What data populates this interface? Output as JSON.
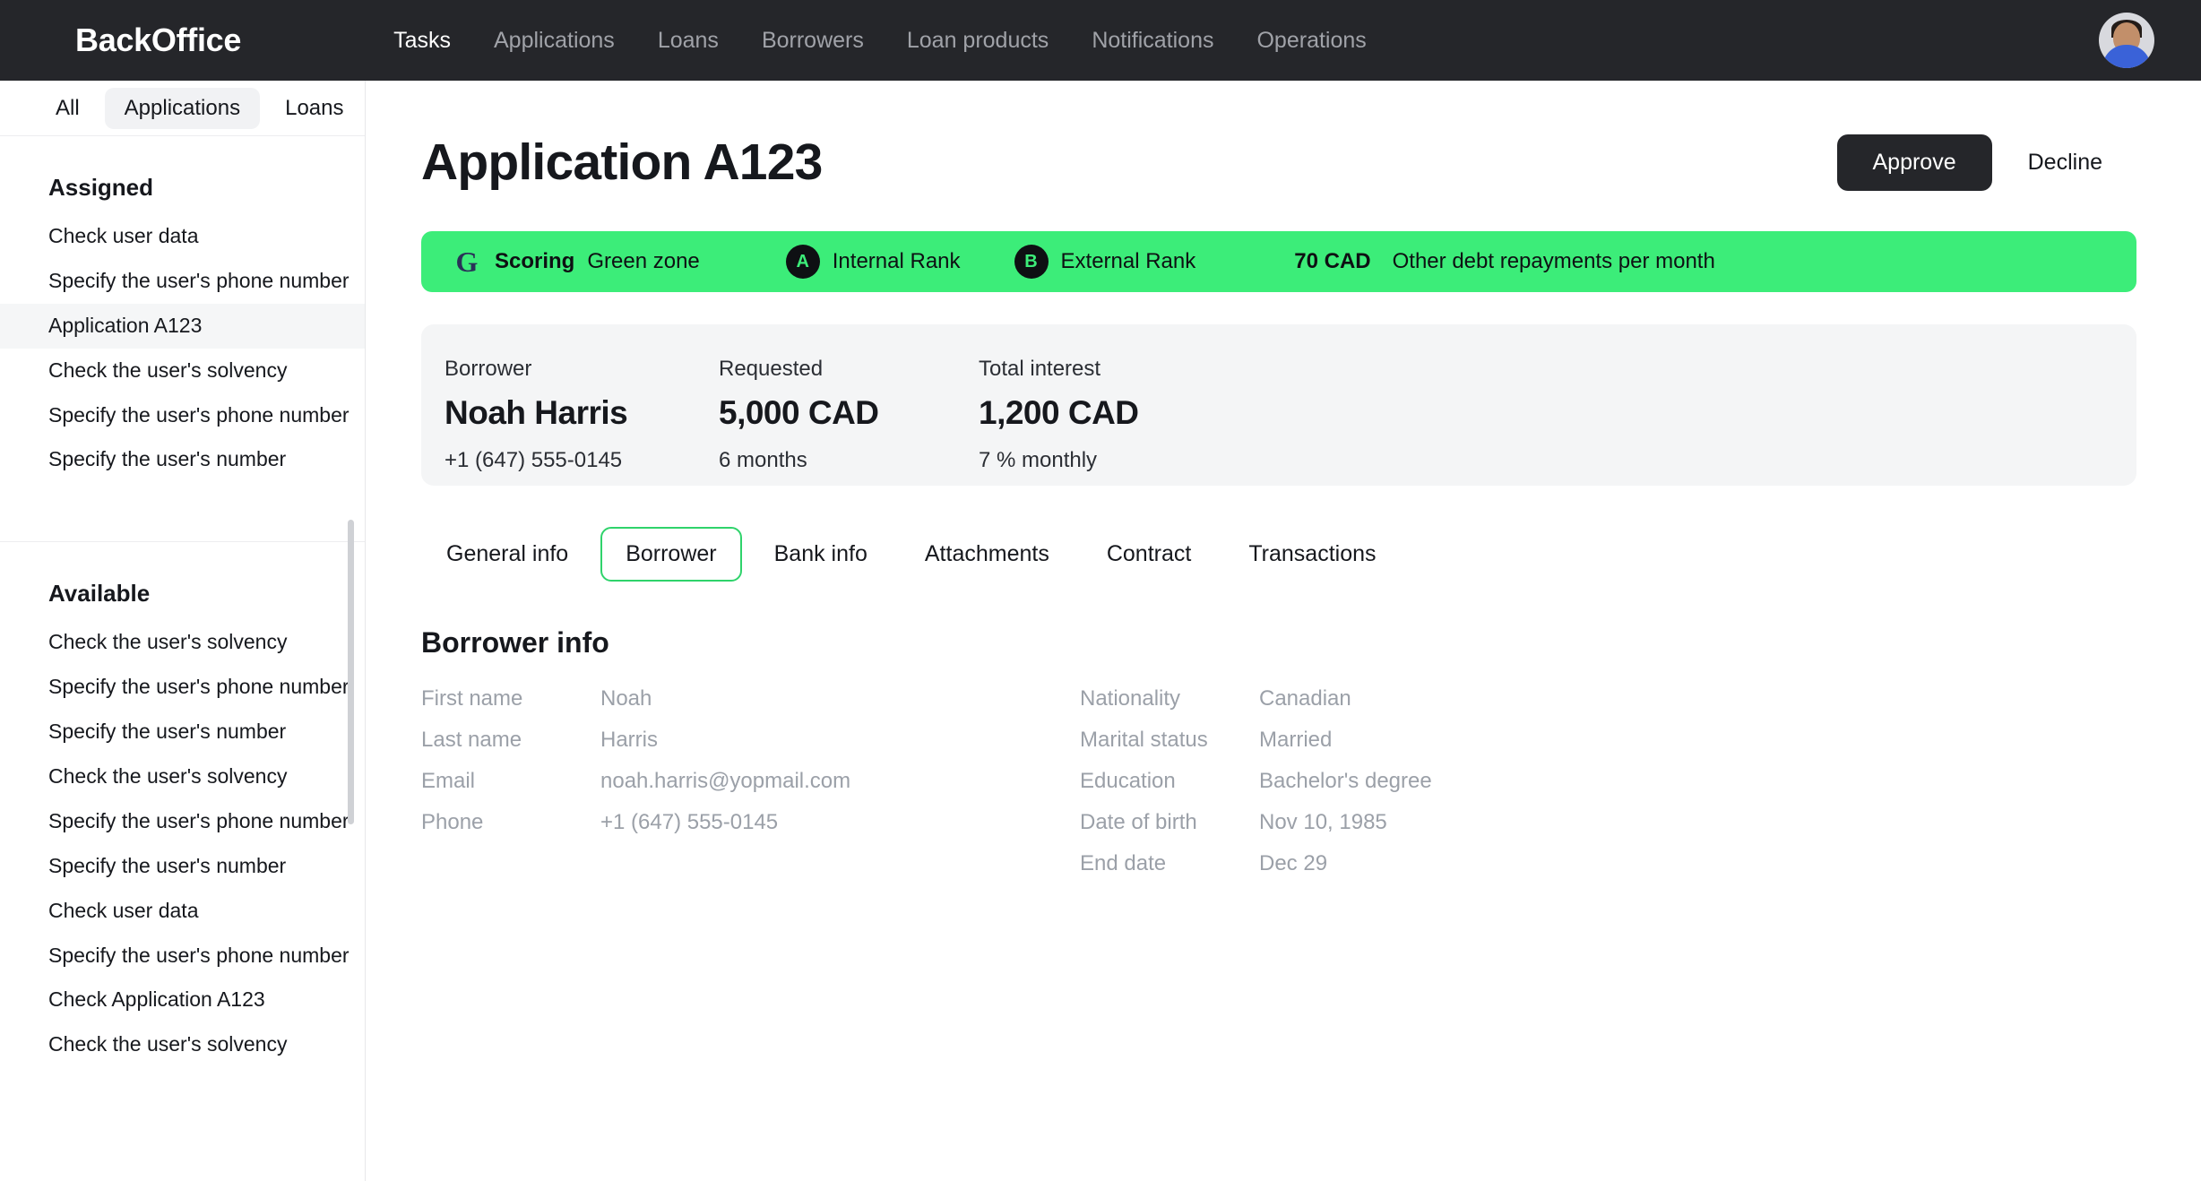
{
  "header": {
    "brand": "BackOffice",
    "nav": [
      {
        "label": "Tasks",
        "active": true
      },
      {
        "label": "Applications",
        "active": false
      },
      {
        "label": "Loans",
        "active": false
      },
      {
        "label": "Borrowers",
        "active": false
      },
      {
        "label": "Loan products",
        "active": false
      },
      {
        "label": "Notifications",
        "active": false
      },
      {
        "label": "Operations",
        "active": false
      }
    ]
  },
  "sidebar": {
    "filters": [
      {
        "label": "All",
        "active": false
      },
      {
        "label": "Applications",
        "active": true
      },
      {
        "label": "Loans",
        "active": false
      }
    ],
    "assigned": {
      "title": "Assigned",
      "items": [
        {
          "label": "Check user data",
          "selected": false
        },
        {
          "label": "Specify the user's phone number",
          "selected": false
        },
        {
          "label": "Application A123",
          "selected": true
        },
        {
          "label": "Check the user's solvency",
          "selected": false
        },
        {
          "label": "Specify the user's phone number",
          "selected": false
        },
        {
          "label": "Specify the user's number",
          "selected": false
        }
      ]
    },
    "available": {
      "title": "Available",
      "items": [
        {
          "label": "Check the user's solvency"
        },
        {
          "label": "Specify the user's phone number"
        },
        {
          "label": "Specify the user's number"
        },
        {
          "label": "Check the user's solvency"
        },
        {
          "label": "Specify the user's phone number"
        },
        {
          "label": "Specify the user's number"
        },
        {
          "label": "Check user data"
        },
        {
          "label": "Specify the user's phone number"
        },
        {
          "label": "Check Application A123"
        },
        {
          "label": "Check the user's solvency"
        }
      ]
    }
  },
  "main": {
    "title": "Application A123",
    "approve_label": "Approve",
    "decline_label": "Decline",
    "banner": {
      "logo_letter": "G",
      "scoring_label": "Scoring",
      "scoring_value": "Green zone",
      "internal_badge": "A",
      "internal_label": "Internal Rank",
      "external_badge": "B",
      "external_label": "External Rank",
      "debt_amount": "70 CAD",
      "debt_label": "Other debt repayments per month",
      "color": "#3ced79"
    },
    "summary": [
      {
        "label": "Borrower",
        "value": "Noah Harris",
        "sub": "+1 (647) 555-0145"
      },
      {
        "label": "Requested",
        "value": "5,000 CAD",
        "sub": "6 months"
      },
      {
        "label": "Total interest",
        "value": "1,200 CAD",
        "sub": "7 % monthly"
      }
    ],
    "tabs": [
      {
        "label": "General info",
        "active": false
      },
      {
        "label": "Borrower",
        "active": true
      },
      {
        "label": "Bank info",
        "active": false
      },
      {
        "label": "Attachments",
        "active": false
      },
      {
        "label": "Contract",
        "active": false
      },
      {
        "label": "Transactions",
        "active": false
      }
    ],
    "borrower_info": {
      "title": "Borrower info",
      "left": [
        {
          "key": "First name",
          "value": "Noah"
        },
        {
          "key": "Last name",
          "value": "Harris"
        },
        {
          "key": "Email",
          "value": "noah.harris@yopmail.com"
        },
        {
          "key": "Phone",
          "value": "+1 (647) 555-0145"
        }
      ],
      "right": [
        {
          "key": "Nationality",
          "value": "Canadian"
        },
        {
          "key": "Marital status",
          "value": "Married"
        },
        {
          "key": "Education",
          "value": "Bachelor's degree"
        },
        {
          "key": "Date of birth",
          "value": "Nov 10, 1985"
        },
        {
          "key": "End date",
          "value": "Dec 29"
        }
      ]
    }
  }
}
